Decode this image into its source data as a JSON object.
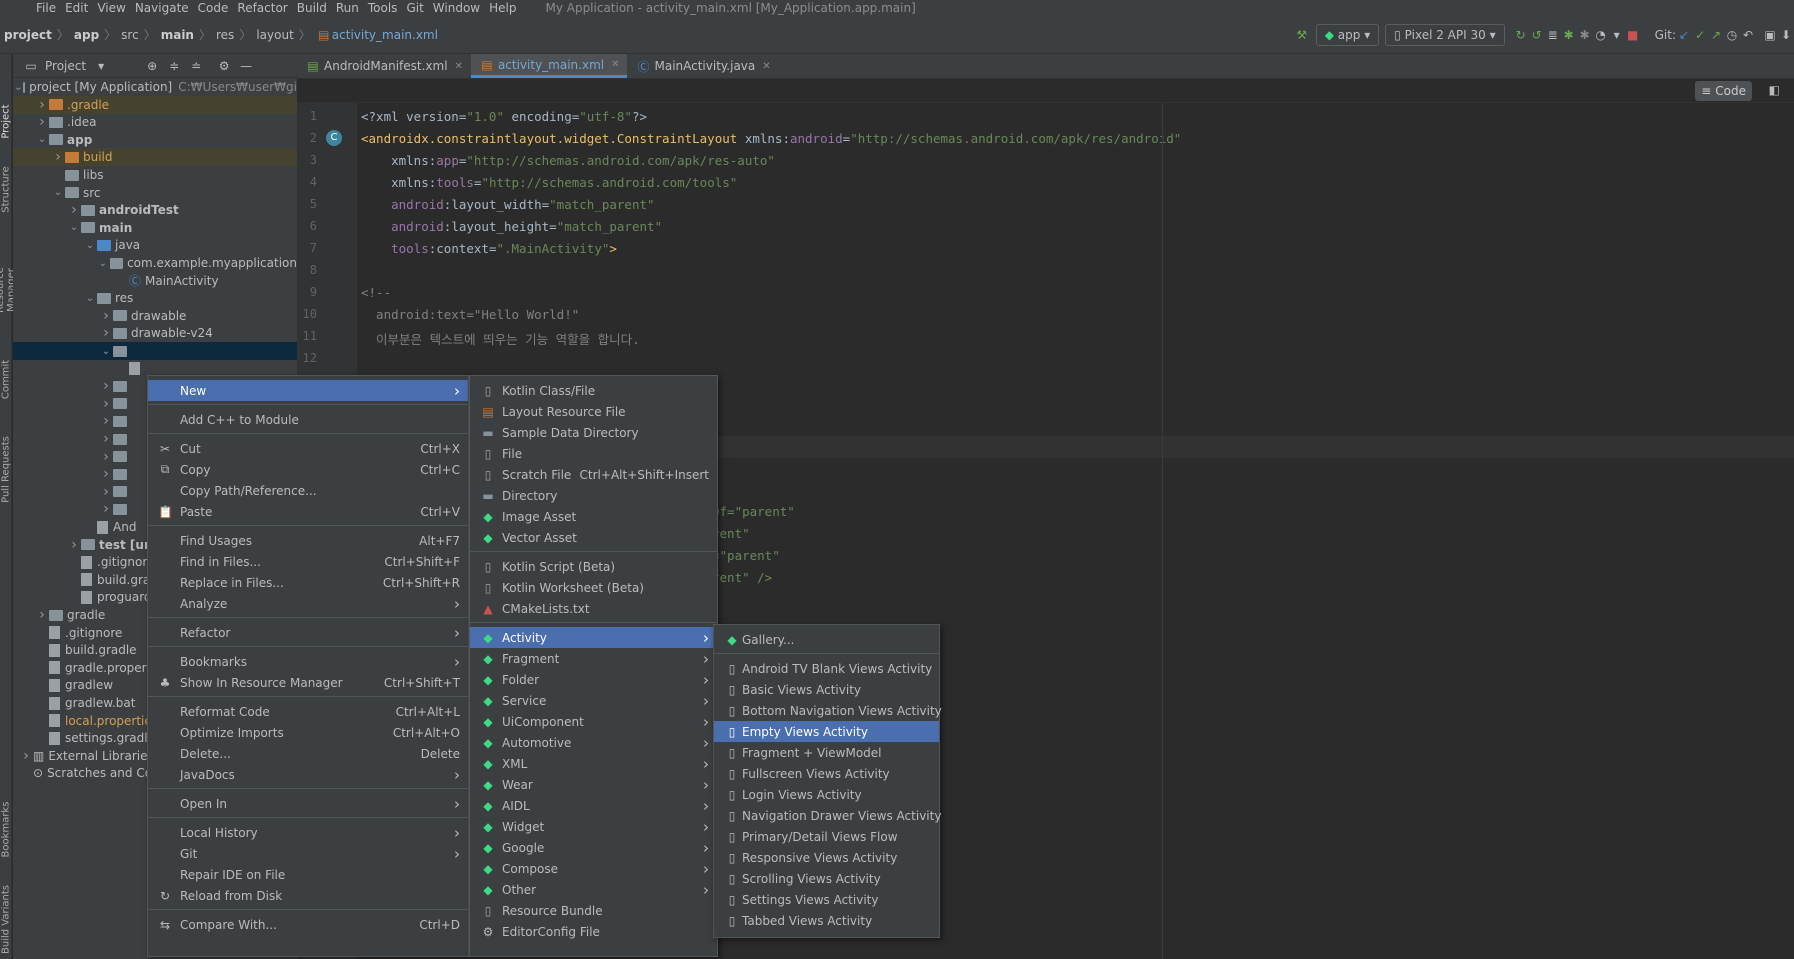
{
  "menubar": {
    "items": [
      "File",
      "Edit",
      "View",
      "Navigate",
      "Code",
      "Refactor",
      "Build",
      "Run",
      "Tools",
      "Git",
      "Window",
      "Help"
    ],
    "title": "My Application - activity_main.xml [My_Application.app.main]"
  },
  "breadcrumb": [
    "project",
    "app",
    "src",
    "main",
    "res",
    "layout",
    "activity_main.xml"
  ],
  "toolbar": {
    "config": "app",
    "device": "Pixel 2 API 30",
    "git_label": "Git:"
  },
  "project_panel": {
    "title": "Project"
  },
  "tree": [
    {
      "label": "project [My Application]",
      "extra": "C:₩Users₩user₩gi",
      "depth": 0,
      "arrow": "v",
      "icon": "folder",
      "color": "#bbbbbb",
      "bold": false
    },
    {
      "label": ".gradle",
      "depth": 1,
      "arrow": ">",
      "icon": "folder-orange",
      "color": "#d4a04d",
      "bold": false,
      "hl": true
    },
    {
      "label": ".idea",
      "depth": 1,
      "arrow": ">",
      "icon": "folder",
      "color": "#bbbbbb",
      "bold": false
    },
    {
      "label": "app",
      "depth": 1,
      "arrow": "v",
      "icon": "folder",
      "color": "#bbbbbb",
      "bold": true
    },
    {
      "label": "build",
      "depth": 2,
      "arrow": ">",
      "icon": "folder-orange",
      "color": "#d4a04d",
      "bold": false,
      "hl": true
    },
    {
      "label": "libs",
      "depth": 2,
      "arrow": "",
      "icon": "folder",
      "color": "#bbbbbb",
      "bold": false
    },
    {
      "label": "src",
      "depth": 2,
      "arrow": "v",
      "icon": "folder",
      "color": "#bbbbbb",
      "bold": false
    },
    {
      "label": "androidTest",
      "depth": 3,
      "arrow": ">",
      "icon": "folder",
      "color": "#bbbbbb",
      "bold": true
    },
    {
      "label": "main",
      "depth": 3,
      "arrow": "v",
      "icon": "folder",
      "color": "#bbbbbb",
      "bold": true
    },
    {
      "label": "java",
      "depth": 4,
      "arrow": "v",
      "icon": "folder-blue",
      "color": "#bbbbbb",
      "bold": false
    },
    {
      "label": "com.example.myapplication",
      "depth": 5,
      "arrow": "v",
      "icon": "folder",
      "color": "#bbbbbb",
      "bold": false
    },
    {
      "label": "MainActivity",
      "depth": 6,
      "arrow": "",
      "icon": "class",
      "color": "#bbbbbb",
      "bold": false
    },
    {
      "label": "res",
      "depth": 4,
      "arrow": "v",
      "icon": "folder",
      "color": "#bbbbbb",
      "bold": false
    },
    {
      "label": "drawable",
      "depth": 5,
      "arrow": ">",
      "icon": "folder",
      "color": "#bbbbbb",
      "bold": false
    },
    {
      "label": "drawable-v24",
      "depth": 5,
      "arrow": ">",
      "icon": "folder",
      "color": "#bbbbbb",
      "bold": false
    },
    {
      "label": "",
      "depth": 5,
      "arrow": "v",
      "icon": "folder",
      "color": "#bbbbbb",
      "bold": false,
      "selected": true
    },
    {
      "label": "",
      "depth": 6,
      "arrow": "",
      "icon": "file",
      "color": "#bbbbbb",
      "bold": false
    },
    {
      "label": "",
      "depth": 5,
      "arrow": ">",
      "icon": "folder",
      "color": "#bbbbbb",
      "bold": false
    },
    {
      "label": "",
      "depth": 5,
      "arrow": ">",
      "icon": "folder",
      "color": "#bbbbbb",
      "bold": false
    },
    {
      "label": "",
      "depth": 5,
      "arrow": ">",
      "icon": "folder",
      "color": "#bbbbbb",
      "bold": false
    },
    {
      "label": "",
      "depth": 5,
      "arrow": ">",
      "icon": "folder",
      "color": "#bbbbbb",
      "bold": false
    },
    {
      "label": "",
      "depth": 5,
      "arrow": ">",
      "icon": "folder",
      "color": "#bbbbbb",
      "bold": false
    },
    {
      "label": "",
      "depth": 5,
      "arrow": ">",
      "icon": "folder",
      "color": "#bbbbbb",
      "bold": false
    },
    {
      "label": "",
      "depth": 5,
      "arrow": ">",
      "icon": "folder",
      "color": "#bbbbbb",
      "bold": false
    },
    {
      "label": "",
      "depth": 5,
      "arrow": ">",
      "icon": "folder",
      "color": "#bbbbbb",
      "bold": false
    },
    {
      "label": "And",
      "depth": 4,
      "arrow": "",
      "icon": "file",
      "color": "#bbbbbb",
      "bold": false
    },
    {
      "label": "test [un",
      "depth": 3,
      "arrow": ">",
      "icon": "folder",
      "color": "#bbbbbb",
      "bold": true
    },
    {
      "label": ".gitignore",
      "depth": 3,
      "arrow": "",
      "icon": "file",
      "color": "#bbbbbb",
      "bold": false
    },
    {
      "label": "build.grad",
      "depth": 3,
      "arrow": "",
      "icon": "file",
      "color": "#bbbbbb",
      "bold": false
    },
    {
      "label": "proguard-",
      "depth": 3,
      "arrow": "",
      "icon": "file",
      "color": "#bbbbbb",
      "bold": false
    },
    {
      "label": "gradle",
      "depth": 1,
      "arrow": ">",
      "icon": "folder",
      "color": "#bbbbbb",
      "bold": false
    },
    {
      "label": ".gitignore",
      "depth": 1,
      "arrow": "",
      "icon": "file",
      "color": "#bbbbbb",
      "bold": false
    },
    {
      "label": "build.gradle",
      "depth": 1,
      "arrow": "",
      "icon": "file",
      "color": "#bbbbbb",
      "bold": false
    },
    {
      "label": "gradle.propert",
      "depth": 1,
      "arrow": "",
      "icon": "file",
      "color": "#bbbbbb",
      "bold": false
    },
    {
      "label": "gradlew",
      "depth": 1,
      "arrow": "",
      "icon": "file",
      "color": "#bbbbbb",
      "bold": false
    },
    {
      "label": "gradlew.bat",
      "depth": 1,
      "arrow": "",
      "icon": "file",
      "color": "#bbbbbb",
      "bold": false
    },
    {
      "label": "local.propertie",
      "depth": 1,
      "arrow": "",
      "icon": "file",
      "color": "#d4a04d",
      "bold": false
    },
    {
      "label": "settings.gradl",
      "depth": 1,
      "arrow": "",
      "icon": "file",
      "color": "#bbbbbb",
      "bold": false
    },
    {
      "label": "External Libraries",
      "depth": 0,
      "arrow": ">",
      "icon": "lib",
      "color": "#bbbbbb",
      "bold": false
    },
    {
      "label": "Scratches and Co",
      "depth": 0,
      "arrow": "",
      "icon": "scratch",
      "color": "#bbbbbb",
      "bold": false
    }
  ],
  "tabs": [
    {
      "label": "AndroidManifest.xml",
      "active": false
    },
    {
      "label": "activity_main.xml",
      "active": true
    },
    {
      "label": "MainActivity.java",
      "active": false
    }
  ],
  "view_mode": "Code",
  "code_lines": [
    {
      "n": "1",
      "html": "<span class='pl'>&lt;?xml version=</span><span class='av'>\"1.0\"</span><span class='pl'> encoding=</span><span class='av'>\"utf-8\"</span><span class='pl'>?&gt;</span>"
    },
    {
      "n": "2",
      "html": "<span class='tag'>&lt;androidx.constraintlayout.widget.ConstraintLayout </span><span class='pl'>xmlns:</span><span class='at'>android</span><span class='pl'>=</span><span class='av'>\"http://schemas.android.com/apk/res/android\"</span>"
    },
    {
      "n": "3",
      "html": "    <span class='pl'>xmlns:</span><span class='at'>app</span><span class='pl'>=</span><span class='av'>\"http://schemas.android.com/apk/res-auto\"</span>"
    },
    {
      "n": "4",
      "html": "    <span class='pl'>xmlns:</span><span class='at'>tools</span><span class='pl'>=</span><span class='av'>\"http://schemas.android.com/tools\"</span>"
    },
    {
      "n": "5",
      "html": "    <span class='at'>android</span><span class='pl'>:layout_width=</span><span class='av'>\"match_parent\"</span>"
    },
    {
      "n": "6",
      "html": "    <span class='at'>android</span><span class='pl'>:layout_height=</span><span class='av'>\"match_parent\"</span>"
    },
    {
      "n": "7",
      "html": "    <span class='at'>tools</span><span class='pl'>:context=</span><span class='av'>\".MainActivity\"</span><span class='tag'>&gt;</span>"
    },
    {
      "n": "8",
      "html": ""
    },
    {
      "n": "9",
      "html": "<span class='cm'>&lt;!--</span>"
    },
    {
      "n": "10",
      "html": "<span class='cm'>  android:text=\"Hello World!\"</span>"
    },
    {
      "n": "11",
      "html": "<span class='cm'>  이부분은 텍스트에 띄우는 기능 역할을 합니다.</span>"
    },
    {
      "n": "12",
      "html": ""
    }
  ],
  "code_fragments": [
    "Of=\"parent\"",
    "rent\"",
    "=\"parent\"",
    "rent\" />"
  ],
  "context_menu": [
    {
      "label": "New",
      "sc": "",
      "sub": true,
      "sel": true,
      "icon": ""
    },
    {
      "sep": true
    },
    {
      "label": "Add C++ to Module",
      "sc": "",
      "sub": false,
      "icon": ""
    },
    {
      "sep": true
    },
    {
      "label": "Cut",
      "sc": "Ctrl+X",
      "sub": false,
      "icon": "✂"
    },
    {
      "label": "Copy",
      "sc": "Ctrl+C",
      "sub": false,
      "icon": "⧉"
    },
    {
      "label": "Copy Path/Reference...",
      "sc": "",
      "sub": false,
      "icon": ""
    },
    {
      "label": "Paste",
      "sc": "Ctrl+V",
      "sub": false,
      "icon": "📋"
    },
    {
      "sep": true
    },
    {
      "label": "Find Usages",
      "sc": "Alt+F7",
      "sub": false,
      "icon": ""
    },
    {
      "label": "Find in Files...",
      "sc": "Ctrl+Shift+F",
      "sub": false,
      "icon": ""
    },
    {
      "label": "Replace in Files...",
      "sc": "Ctrl+Shift+R",
      "sub": false,
      "icon": ""
    },
    {
      "label": "Analyze",
      "sc": "",
      "sub": true,
      "icon": ""
    },
    {
      "sep": true
    },
    {
      "label": "Refactor",
      "sc": "",
      "sub": true,
      "icon": ""
    },
    {
      "sep": true
    },
    {
      "label": "Bookmarks",
      "sc": "",
      "sub": true,
      "icon": ""
    },
    {
      "label": "Show In Resource Manager",
      "sc": "Ctrl+Shift+T",
      "sub": false,
      "icon": "♣"
    },
    {
      "sep": true
    },
    {
      "label": "Reformat Code",
      "sc": "Ctrl+Alt+L",
      "sub": false,
      "icon": ""
    },
    {
      "label": "Optimize Imports",
      "sc": "Ctrl+Alt+O",
      "sub": false,
      "icon": ""
    },
    {
      "label": "Delete...",
      "sc": "Delete",
      "sub": false,
      "icon": ""
    },
    {
      "label": "JavaDocs",
      "sc": "",
      "sub": true,
      "icon": ""
    },
    {
      "sep": true
    },
    {
      "label": "Open In",
      "sc": "",
      "sub": true,
      "icon": ""
    },
    {
      "sep": true
    },
    {
      "label": "Local History",
      "sc": "",
      "sub": true,
      "icon": ""
    },
    {
      "label": "Git",
      "sc": "",
      "sub": true,
      "icon": ""
    },
    {
      "label": "Repair IDE on File",
      "sc": "",
      "sub": false,
      "icon": ""
    },
    {
      "label": "Reload from Disk",
      "sc": "",
      "sub": false,
      "icon": "↻"
    },
    {
      "sep": true
    },
    {
      "label": "Compare With...",
      "sc": "Ctrl+D",
      "sub": false,
      "icon": "⇆"
    }
  ],
  "new_menu": [
    {
      "label": "Kotlin Class/File",
      "sc": "",
      "sub": false,
      "icon": "file"
    },
    {
      "label": "Layout Resource File",
      "sc": "",
      "sub": false,
      "icon": "layout"
    },
    {
      "label": "Sample Data Directory",
      "sc": "",
      "sub": false,
      "icon": "folder"
    },
    {
      "label": "File",
      "sc": "",
      "sub": false,
      "icon": "file"
    },
    {
      "label": "Scratch File",
      "sc": "Ctrl+Alt+Shift+Insert",
      "sub": false,
      "icon": "file"
    },
    {
      "label": "Directory",
      "sc": "",
      "sub": false,
      "icon": "folder"
    },
    {
      "label": "Image Asset",
      "sc": "",
      "sub": false,
      "icon": "android"
    },
    {
      "label": "Vector Asset",
      "sc": "",
      "sub": false,
      "icon": "android"
    },
    {
      "sep": true
    },
    {
      "label": "Kotlin Script (Beta)",
      "sc": "",
      "sub": false,
      "icon": "file"
    },
    {
      "label": "Kotlin Worksheet (Beta)",
      "sc": "",
      "sub": false,
      "icon": "file"
    },
    {
      "label": "CMakeLists.txt",
      "sc": "",
      "sub": false,
      "icon": "cmake"
    },
    {
      "sep": true
    },
    {
      "label": "Activity",
      "sc": "",
      "sub": true,
      "sel": true,
      "icon": "android"
    },
    {
      "label": "Fragment",
      "sc": "",
      "sub": true,
      "icon": "android"
    },
    {
      "label": "Folder",
      "sc": "",
      "sub": true,
      "icon": "android"
    },
    {
      "label": "Service",
      "sc": "",
      "sub": true,
      "icon": "android"
    },
    {
      "label": "UiComponent",
      "sc": "",
      "sub": true,
      "icon": "android"
    },
    {
      "label": "Automotive",
      "sc": "",
      "sub": true,
      "icon": "android"
    },
    {
      "label": "XML",
      "sc": "",
      "sub": true,
      "icon": "android"
    },
    {
      "label": "Wear",
      "sc": "",
      "sub": true,
      "icon": "android"
    },
    {
      "label": "AIDL",
      "sc": "",
      "sub": true,
      "icon": "android"
    },
    {
      "label": "Widget",
      "sc": "",
      "sub": true,
      "icon": "android"
    },
    {
      "label": "Google",
      "sc": "",
      "sub": true,
      "icon": "android"
    },
    {
      "label": "Compose",
      "sc": "",
      "sub": true,
      "icon": "android"
    },
    {
      "label": "Other",
      "sc": "",
      "sub": true,
      "icon": "android"
    },
    {
      "label": "Resource Bundle",
      "sc": "",
      "sub": false,
      "icon": "file"
    },
    {
      "label": "EditorConfig File",
      "sc": "",
      "sub": false,
      "icon": "gear"
    }
  ],
  "activity_menu": [
    {
      "label": "Gallery...",
      "icon": "android"
    },
    {
      "sep": true
    },
    {
      "label": "Android TV Blank Views Activity",
      "icon": "phone"
    },
    {
      "label": "Basic Views Activity",
      "icon": "phone"
    },
    {
      "label": "Bottom Navigation Views Activity",
      "icon": "phone"
    },
    {
      "label": "Empty Views Activity",
      "icon": "phone",
      "sel": true
    },
    {
      "label": "Fragment + ViewModel",
      "icon": "phone"
    },
    {
      "label": "Fullscreen Views Activity",
      "icon": "phone"
    },
    {
      "label": "Login Views Activity",
      "icon": "phone"
    },
    {
      "label": "Navigation Drawer Views Activity",
      "icon": "phone"
    },
    {
      "label": "Primary/Detail Views Flow",
      "icon": "phone"
    },
    {
      "label": "Responsive Views Activity",
      "icon": "phone"
    },
    {
      "label": "Scrolling Views Activity",
      "icon": "phone"
    },
    {
      "label": "Settings Views Activity",
      "icon": "phone"
    },
    {
      "label": "Tabbed Views Activity",
      "icon": "phone"
    }
  ],
  "left_strip": [
    "Project",
    "Structure",
    "Resource Manager",
    "Commit",
    "Pull Requests",
    "Bookmarks",
    "Build Variants"
  ]
}
